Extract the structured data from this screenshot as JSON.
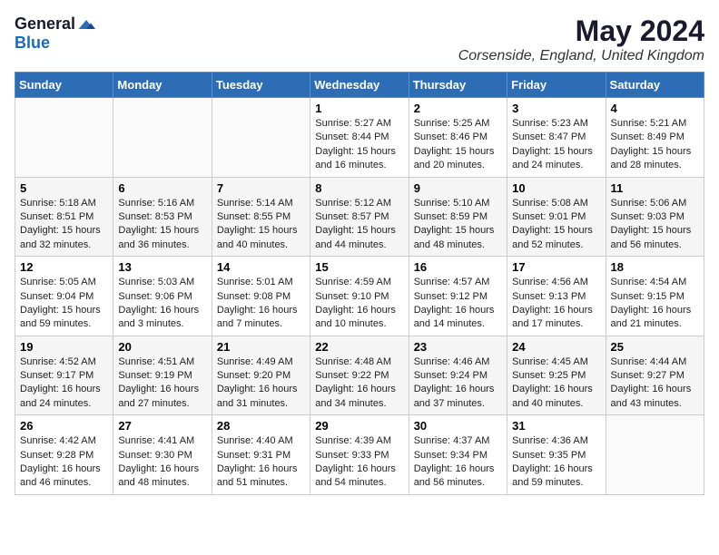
{
  "logo": {
    "general": "General",
    "blue": "Blue"
  },
  "title": "May 2024",
  "subtitle": "Corsenside, England, United Kingdom",
  "days_of_week": [
    "Sunday",
    "Monday",
    "Tuesday",
    "Wednesday",
    "Thursday",
    "Friday",
    "Saturday"
  ],
  "weeks": [
    [
      {
        "day": "",
        "info": ""
      },
      {
        "day": "",
        "info": ""
      },
      {
        "day": "",
        "info": ""
      },
      {
        "day": "1",
        "info": "Sunrise: 5:27 AM\nSunset: 8:44 PM\nDaylight: 15 hours\nand 16 minutes."
      },
      {
        "day": "2",
        "info": "Sunrise: 5:25 AM\nSunset: 8:46 PM\nDaylight: 15 hours\nand 20 minutes."
      },
      {
        "day": "3",
        "info": "Sunrise: 5:23 AM\nSunset: 8:47 PM\nDaylight: 15 hours\nand 24 minutes."
      },
      {
        "day": "4",
        "info": "Sunrise: 5:21 AM\nSunset: 8:49 PM\nDaylight: 15 hours\nand 28 minutes."
      }
    ],
    [
      {
        "day": "5",
        "info": "Sunrise: 5:18 AM\nSunset: 8:51 PM\nDaylight: 15 hours\nand 32 minutes."
      },
      {
        "day": "6",
        "info": "Sunrise: 5:16 AM\nSunset: 8:53 PM\nDaylight: 15 hours\nand 36 minutes."
      },
      {
        "day": "7",
        "info": "Sunrise: 5:14 AM\nSunset: 8:55 PM\nDaylight: 15 hours\nand 40 minutes."
      },
      {
        "day": "8",
        "info": "Sunrise: 5:12 AM\nSunset: 8:57 PM\nDaylight: 15 hours\nand 44 minutes."
      },
      {
        "day": "9",
        "info": "Sunrise: 5:10 AM\nSunset: 8:59 PM\nDaylight: 15 hours\nand 48 minutes."
      },
      {
        "day": "10",
        "info": "Sunrise: 5:08 AM\nSunset: 9:01 PM\nDaylight: 15 hours\nand 52 minutes."
      },
      {
        "day": "11",
        "info": "Sunrise: 5:06 AM\nSunset: 9:03 PM\nDaylight: 15 hours\nand 56 minutes."
      }
    ],
    [
      {
        "day": "12",
        "info": "Sunrise: 5:05 AM\nSunset: 9:04 PM\nDaylight: 15 hours\nand 59 minutes."
      },
      {
        "day": "13",
        "info": "Sunrise: 5:03 AM\nSunset: 9:06 PM\nDaylight: 16 hours\nand 3 minutes."
      },
      {
        "day": "14",
        "info": "Sunrise: 5:01 AM\nSunset: 9:08 PM\nDaylight: 16 hours\nand 7 minutes."
      },
      {
        "day": "15",
        "info": "Sunrise: 4:59 AM\nSunset: 9:10 PM\nDaylight: 16 hours\nand 10 minutes."
      },
      {
        "day": "16",
        "info": "Sunrise: 4:57 AM\nSunset: 9:12 PM\nDaylight: 16 hours\nand 14 minutes."
      },
      {
        "day": "17",
        "info": "Sunrise: 4:56 AM\nSunset: 9:13 PM\nDaylight: 16 hours\nand 17 minutes."
      },
      {
        "day": "18",
        "info": "Sunrise: 4:54 AM\nSunset: 9:15 PM\nDaylight: 16 hours\nand 21 minutes."
      }
    ],
    [
      {
        "day": "19",
        "info": "Sunrise: 4:52 AM\nSunset: 9:17 PM\nDaylight: 16 hours\nand 24 minutes."
      },
      {
        "day": "20",
        "info": "Sunrise: 4:51 AM\nSunset: 9:19 PM\nDaylight: 16 hours\nand 27 minutes."
      },
      {
        "day": "21",
        "info": "Sunrise: 4:49 AM\nSunset: 9:20 PM\nDaylight: 16 hours\nand 31 minutes."
      },
      {
        "day": "22",
        "info": "Sunrise: 4:48 AM\nSunset: 9:22 PM\nDaylight: 16 hours\nand 34 minutes."
      },
      {
        "day": "23",
        "info": "Sunrise: 4:46 AM\nSunset: 9:24 PM\nDaylight: 16 hours\nand 37 minutes."
      },
      {
        "day": "24",
        "info": "Sunrise: 4:45 AM\nSunset: 9:25 PM\nDaylight: 16 hours\nand 40 minutes."
      },
      {
        "day": "25",
        "info": "Sunrise: 4:44 AM\nSunset: 9:27 PM\nDaylight: 16 hours\nand 43 minutes."
      }
    ],
    [
      {
        "day": "26",
        "info": "Sunrise: 4:42 AM\nSunset: 9:28 PM\nDaylight: 16 hours\nand 46 minutes."
      },
      {
        "day": "27",
        "info": "Sunrise: 4:41 AM\nSunset: 9:30 PM\nDaylight: 16 hours\nand 48 minutes."
      },
      {
        "day": "28",
        "info": "Sunrise: 4:40 AM\nSunset: 9:31 PM\nDaylight: 16 hours\nand 51 minutes."
      },
      {
        "day": "29",
        "info": "Sunrise: 4:39 AM\nSunset: 9:33 PM\nDaylight: 16 hours\nand 54 minutes."
      },
      {
        "day": "30",
        "info": "Sunrise: 4:37 AM\nSunset: 9:34 PM\nDaylight: 16 hours\nand 56 minutes."
      },
      {
        "day": "31",
        "info": "Sunrise: 4:36 AM\nSunset: 9:35 PM\nDaylight: 16 hours\nand 59 minutes."
      },
      {
        "day": "",
        "info": ""
      }
    ]
  ]
}
